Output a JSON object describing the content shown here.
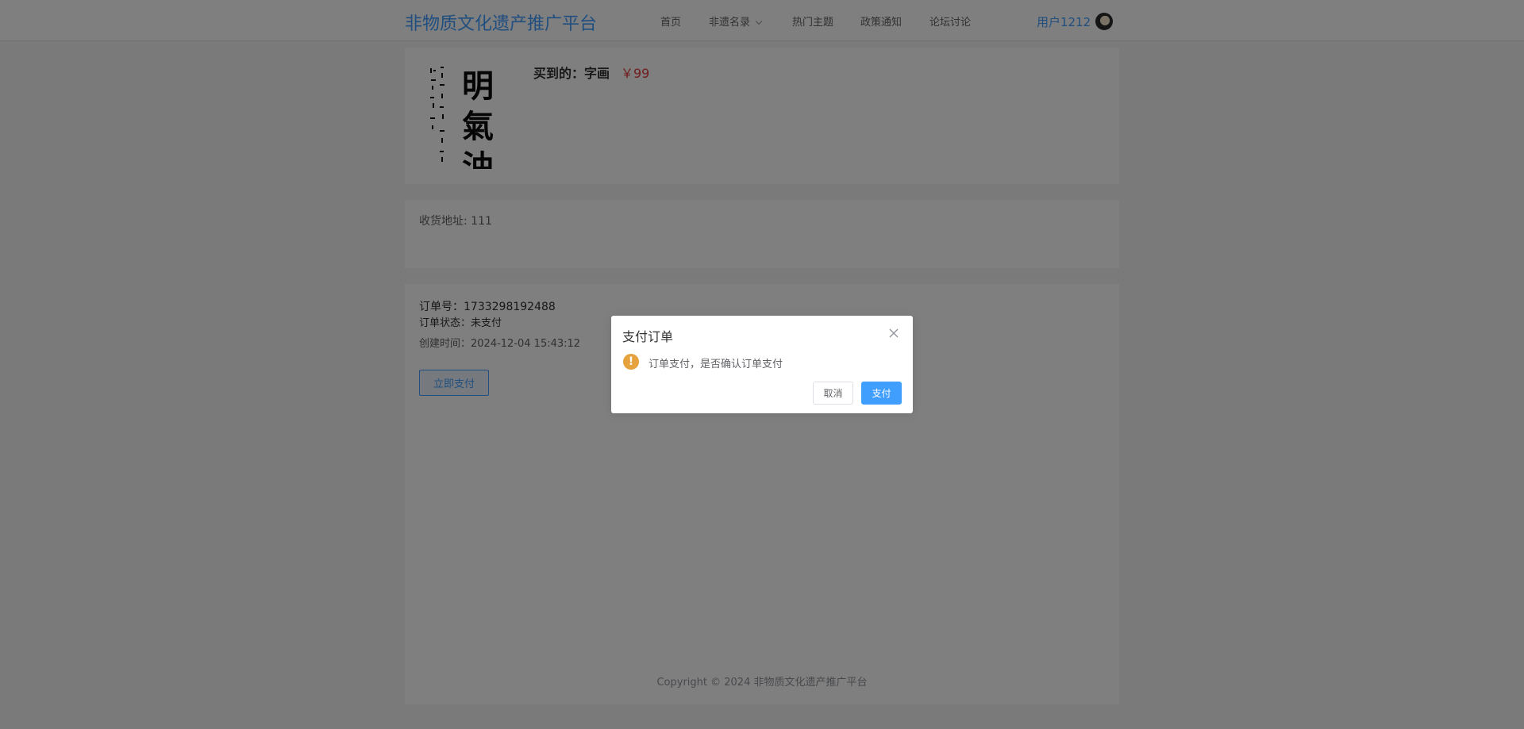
{
  "header": {
    "brand": "非物质文化遗产推广平台",
    "nav": [
      {
        "label": "首页"
      },
      {
        "label": "非遗名录"
      },
      {
        "label": "热门主题"
      },
      {
        "label": "政策通知"
      },
      {
        "label": "论坛讨论"
      }
    ],
    "user_name": "用户1212",
    "avatar_icon": "user-avatar"
  },
  "product": {
    "title_label": "买到的：字画",
    "price": "￥99",
    "image_icon": "calligraphy-painting"
  },
  "address": {
    "text": "收货地址: 111"
  },
  "order": {
    "number": "订单号：1733298192488",
    "status": "订单状态：未支付",
    "created": "创建时间：2024-12-04 15:43:12",
    "pay_button": "立即支付"
  },
  "footer": {
    "copyright": "Copyright © 2024 非物质文化遗产推广平台"
  },
  "dialog": {
    "title": "支付订单",
    "message": "订单支付，是否确认订单支付",
    "icon": "warning-icon",
    "cancel_label": "取消",
    "confirm_label": "支付"
  },
  "colors": {
    "accent": "#409eff",
    "price": "#e4393c",
    "warning": "#e6a23c"
  }
}
